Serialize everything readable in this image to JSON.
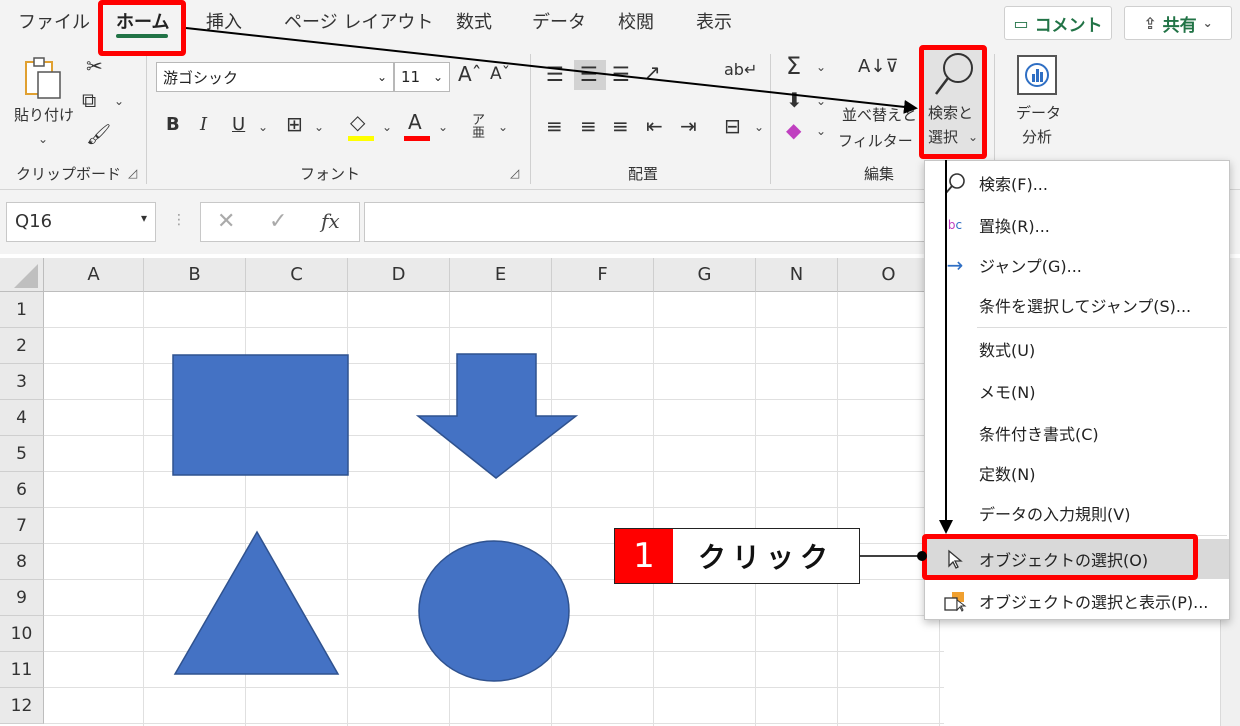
{
  "tabs": [
    "ファイル",
    "ホーム",
    "挿入",
    "ページ レイアウト",
    "数式",
    "データ",
    "校閲",
    "表示"
  ],
  "active_tab": "ホーム",
  "top_buttons": {
    "comment": "コメント",
    "share": "共有"
  },
  "ribbon": {
    "clipboard": {
      "paste": "貼り付け",
      "label": "クリップボード"
    },
    "font": {
      "name": "游ゴシック",
      "size": "11",
      "label": "フォント"
    },
    "alignment": {
      "label": "配置"
    },
    "editing": {
      "sort_filter_line1": "並べ替えと",
      "sort_filter_line2": "フィルター",
      "find_select_line1": "検索と",
      "find_select_line2": "選択",
      "label": "編集"
    },
    "analysis": {
      "line1": "データ",
      "line2": "分析"
    }
  },
  "formula_bar": {
    "name_box": "Q16",
    "fx": "fx",
    "formula": ""
  },
  "grid": {
    "columns": [
      "A",
      "B",
      "C",
      "D",
      "E",
      "F",
      "G",
      "N",
      "O"
    ],
    "rows": [
      "1",
      "2",
      "3",
      "4",
      "5",
      "6",
      "7",
      "8",
      "9",
      "10",
      "11",
      "12"
    ]
  },
  "shapes": {
    "fill": "#4472c4",
    "stroke": "#2f528f"
  },
  "dropdown": {
    "items": [
      {
        "label": "検索(F)...",
        "icon": "search-icon"
      },
      {
        "label": "置換(R)...",
        "icon": "replace-icon"
      },
      {
        "label": "ジャンプ(G)...",
        "icon": "arrow-right-icon"
      },
      {
        "label": "条件を選択してジャンプ(S)...",
        "icon": ""
      },
      {
        "label": "数式(U)",
        "icon": ""
      },
      {
        "label": "メモ(N)",
        "icon": ""
      },
      {
        "label": "条件付き書式(C)",
        "icon": ""
      },
      {
        "label": "定数(N)",
        "icon": ""
      },
      {
        "label": "データの入力規則(V)",
        "icon": ""
      },
      {
        "label": "オブジェクトの選択(O)",
        "icon": "cursor-icon"
      },
      {
        "label": "オブジェクトの選択と表示(P)...",
        "icon": "selection-pane-icon"
      }
    ]
  },
  "callout": {
    "number": "1",
    "text": "クリック"
  },
  "colors": {
    "accent": "#217346",
    "highlight": "#ff0000",
    "annotation": "#000000"
  }
}
